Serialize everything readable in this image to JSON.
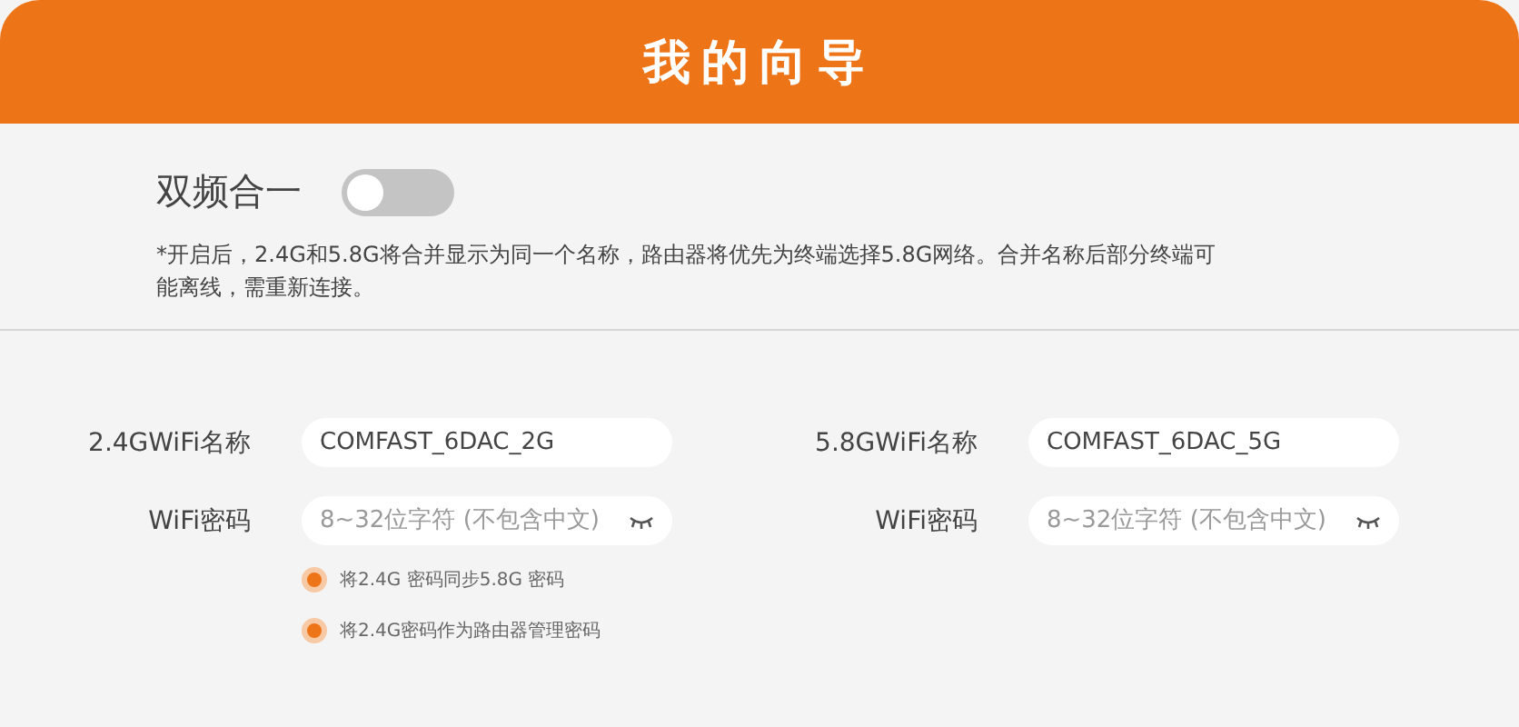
{
  "header": {
    "title": "我的向导"
  },
  "dual_band": {
    "label": "双频合一",
    "on": false,
    "note": "*开启后，2.4G和5.8G将合并显示为同一个名称，路由器将优先为终端选择5.8G网络。合并名称后部分终端可能离线，需重新连接。"
  },
  "bands": [
    {
      "name_label": "2.4GWiFi名称",
      "name_value": "COMFAST_6DAC_2G",
      "password_label": "WiFi密码",
      "password_placeholder": "8~32位字符 (不包含中文)",
      "options": [
        {
          "label": "将2.4G 密码同步5.8G 密码",
          "checked": true
        },
        {
          "label": "将2.4G密码作为路由器管理密码",
          "checked": true
        }
      ]
    },
    {
      "name_label": "5.8GWiFi名称",
      "name_value": "COMFAST_6DAC_5G",
      "password_label": "WiFi密码",
      "password_placeholder": "8~32位字符 (不包含中文)"
    }
  ]
}
